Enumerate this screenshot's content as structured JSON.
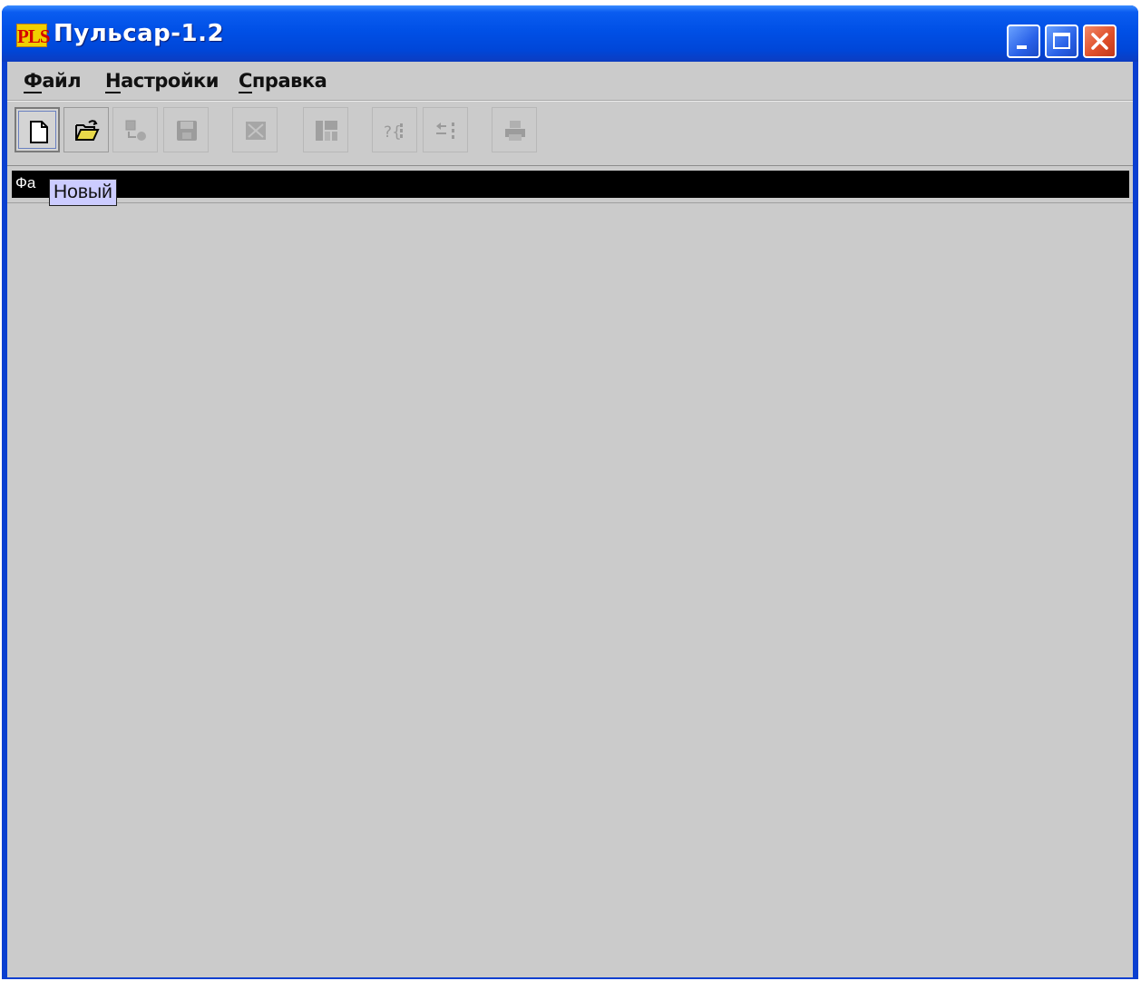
{
  "window": {
    "icon_text": "PLS",
    "title": "Пульсар-1.2"
  },
  "menu": {
    "file": {
      "label": "Файл",
      "mnemonic": "Ф",
      "rest": "айл"
    },
    "settings": {
      "label": "Настройки",
      "mnemonic": "Н",
      "rest": "астройки"
    },
    "help": {
      "label": "Справка",
      "mnemonic": "С",
      "rest": "правка"
    }
  },
  "toolbar": {
    "buttons": [
      {
        "name": "new",
        "icon": "new-document-icon",
        "enabled": true
      },
      {
        "name": "open",
        "icon": "open-folder-icon",
        "enabled": true
      },
      {
        "name": "convert",
        "icon": "database-convert-icon",
        "enabled": false
      },
      {
        "name": "save",
        "icon": "floppy-disk-icon",
        "enabled": false
      },
      {
        "name": "close",
        "icon": "close-document-icon",
        "enabled": false
      },
      {
        "name": "columns",
        "icon": "columns-icon",
        "enabled": false
      },
      {
        "name": "query",
        "icon": "query-icon",
        "enabled": false
      },
      {
        "name": "align",
        "icon": "align-icon",
        "enabled": false
      },
      {
        "name": "print",
        "icon": "printer-icon",
        "enabled": false
      }
    ]
  },
  "filebar": {
    "label": "Фа"
  },
  "tooltip": {
    "text": "Новый"
  },
  "colors": {
    "titlebar": "#0050e6",
    "client_bg": "#cbcbcb",
    "tooltip_bg": "#ccccff",
    "filebar_bg": "#000000"
  }
}
